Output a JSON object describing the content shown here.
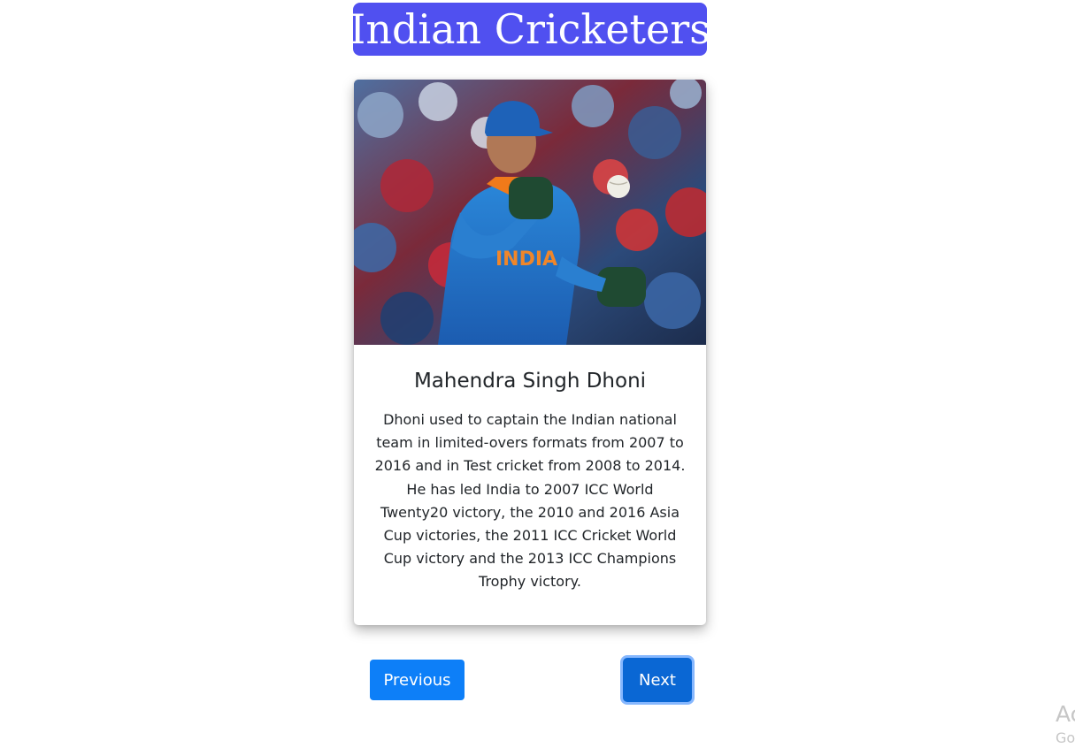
{
  "header": {
    "title": "Indian Cricketers",
    "background_color": "#5050f0"
  },
  "card": {
    "image_subject": "cricketer-photo",
    "name": "Mahendra Singh Dhoni",
    "description": "Dhoni used to captain the Indian national team in limited-overs formats from 2007 to 2016 and in Test cricket from 2008 to 2014. He has led India to 2007 ICC World Twenty20 victory, the 2010 and 2016 Asia Cup victories, the 2011 ICC Cricket World Cup victory and the 2013 ICC Champions Trophy victory.",
    "jersey_text": "INDIA"
  },
  "navigation": {
    "previous_label": "Previous",
    "next_label": "Next",
    "button_color": "#0d7ff8"
  },
  "watermark": {
    "line1": "Ac",
    "line2": "Go"
  }
}
